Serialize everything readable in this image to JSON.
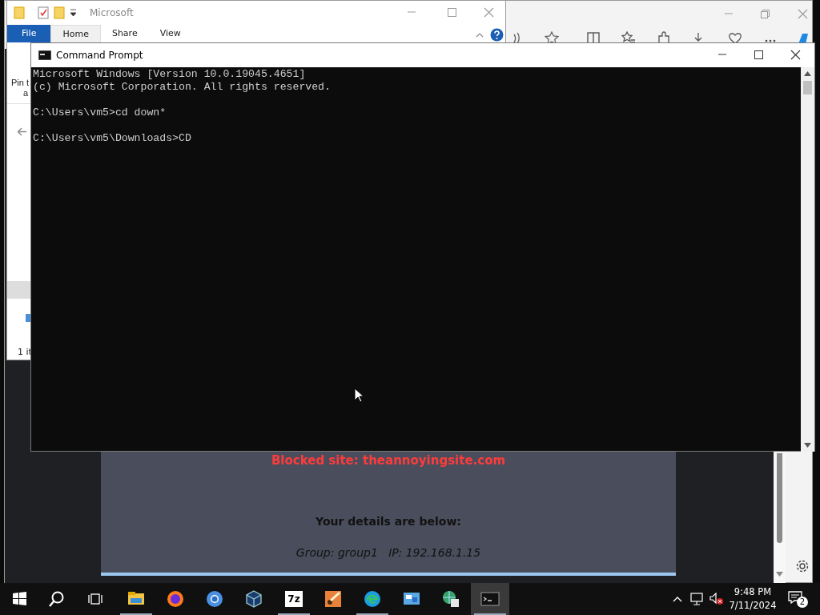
{
  "browser": {
    "blocked_message": "Blocked site: theannoyingsite.com",
    "details_heading": "Your details are below:",
    "details": "Group: group1   IP: 192.168.1.15"
  },
  "explorer": {
    "title": "Microsoft",
    "tabs": [
      {
        "label": "File",
        "kind": "menu",
        "selected": false
      },
      {
        "label": "Home",
        "kind": "tab",
        "selected": true
      },
      {
        "label": "Share",
        "kind": "tab",
        "selected": false
      },
      {
        "label": "View",
        "kind": "tab",
        "selected": false
      }
    ],
    "nav_text": [
      "Pin t",
      "a"
    ],
    "status": "1 it"
  },
  "cmd": {
    "title": "Command Prompt",
    "output_blocks": [
      [
        "Microsoft Windows [Version 10.0.19045.4651]",
        "(c) Microsoft Corporation. All rights reserved."
      ],
      [
        "C:\\Users\\vm5>cd down*"
      ],
      [
        "C:\\Users\\vm5\\Downloads>CD"
      ]
    ]
  },
  "taskbar": {
    "apps": [
      {
        "kind": "folder",
        "running": true,
        "active": false
      },
      {
        "kind": "firefox",
        "running": false,
        "active": false
      },
      {
        "kind": "chrome",
        "running": false,
        "active": false
      },
      {
        "kind": "cube",
        "running": false,
        "active": false
      },
      {
        "kind": "sevenzip",
        "label": "7z",
        "running": true,
        "active": false
      },
      {
        "kind": "paint",
        "running": false,
        "active": false
      },
      {
        "kind": "edge",
        "running": true,
        "active": false
      },
      {
        "kind": "remote",
        "running": false,
        "active": false
      },
      {
        "kind": "globe",
        "running": false,
        "active": false
      },
      {
        "kind": "terminal",
        "running": true,
        "active": true
      }
    ],
    "time": "9:48 PM",
    "date": "7/11/2024",
    "notifications": "2"
  }
}
